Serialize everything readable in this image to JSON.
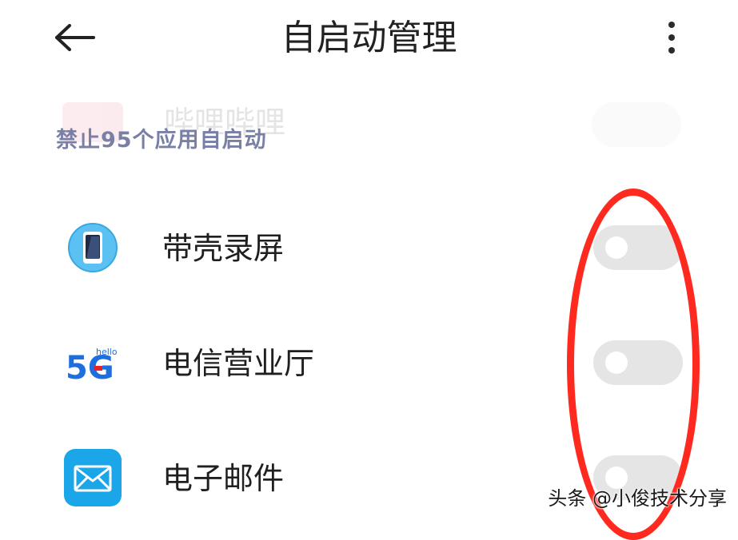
{
  "header": {
    "title": "自启动管理",
    "back_icon": "back-arrow-icon",
    "more_icon": "more-vert-icon"
  },
  "faded_item": {
    "name": "哔哩哔哩"
  },
  "section": {
    "label": "禁止95个应用自启动"
  },
  "apps": [
    {
      "name": "带壳录屏",
      "icon": "phone-screen-recorder-icon",
      "enabled": false
    },
    {
      "name": "电信营业厅",
      "icon": "5g-hello-icon",
      "icon_text": "5G",
      "icon_subtext": "hello",
      "enabled": false
    },
    {
      "name": "电子邮件",
      "icon": "mail-icon",
      "enabled": false
    }
  ],
  "watermark": "头条 @小俊技术分享",
  "colors": {
    "section_label": "#7a7fa6",
    "toggle_off": "#e5e5e5",
    "annotation": "#ff2a1f",
    "mail_icon_bg": "#1aa6e8",
    "screen_recorder_icon_bg": "#5bc0f2"
  }
}
